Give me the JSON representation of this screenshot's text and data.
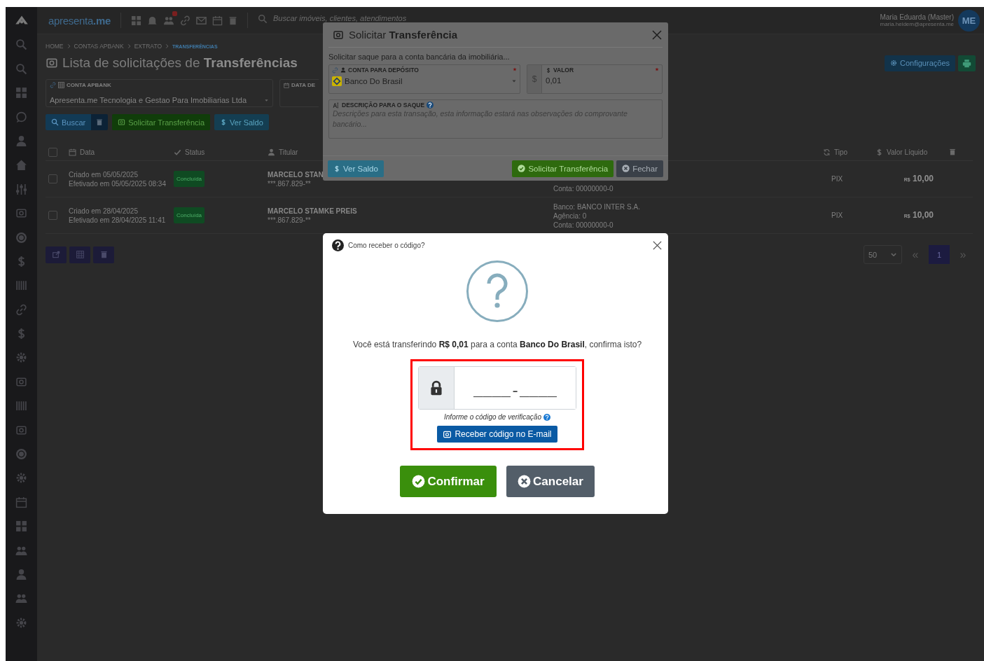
{
  "top_bar": {
    "logo": "apresenta**.me**",
    "search": {
      "placeholder": "Buscar imóveis, clientes, atendimentos"
    },
    "user": {
      "name": "Maria Eduarda (Master)",
      "email": "maria.heidem@apresenta.me",
      "initials": "ME"
    }
  },
  "breadcrumb": [
    {
      "label": "HOME",
      "current": false
    },
    {
      "label": "CONTAS APBANK",
      "current": false
    },
    {
      "label": "EXTRATO",
      "current": false
    },
    {
      "label": "TRANSFERÊNCIAS",
      "current": true
    }
  ],
  "page_title": "Lista de solicitações de **Transferências**",
  "header_buttons": [
    {
      "kind": "settings",
      "label": "Configurações"
    },
    {
      "kind": "print"
    }
  ],
  "filters": {
    "account": {
      "label": "CONTA APBANK",
      "value": "Apresenta.me Tecnologia e Gestao Para Imobiliarias Ltda"
    },
    "date": {
      "label": "DATA DE"
    }
  },
  "actions": [
    {
      "kind": "search",
      "label": "Buscar"
    },
    {
      "kind": "clear"
    },
    {
      "kind": "request",
      "label": "Solicitar Transferência"
    },
    {
      "kind": "balance",
      "label": "Ver Saldo"
    }
  ],
  "table": {
    "select_all": {
      "checked": false
    },
    "columns": [
      {
        "kind": "date",
        "label": "Data"
      },
      {
        "kind": "status",
        "label": "Status"
      },
      {
        "kind": "holder",
        "label": "Titular"
      },
      {
        "kind": "type",
        "label": "Tipo"
      },
      {
        "kind": "amount",
        "label": "Valor Líquido"
      }
    ],
    "rows": [
      {
        "selected": false,
        "created": "Criado em 05/05/2025",
        "done": "Efetivado em 05/05/2025 08:34",
        "status": "Concluída",
        "holder": "MARCELO STAN",
        "document": "***.867.829-**",
        "bank": [
          "Conta: 00000000-0"
        ],
        "type": "PIX",
        "currency": "R$",
        "amount": "10,00"
      },
      {
        "selected": false,
        "created": "Criado em 28/04/2025",
        "done": "Efetivado em 28/04/2025 11:41",
        "status": "Concluída",
        "holder": "MARCELO STAMKE PREIS",
        "document": "***.867.829-**",
        "bank": [
          "Banco: BANCO INTER S.A.",
          "Agência: 0",
          "Conta: 00000000-0"
        ],
        "type": "PIX",
        "currency": "R$",
        "amount": "10,00"
      }
    ]
  },
  "bulk_actions": [
    {
      "kind": "export"
    },
    {
      "kind": "columns"
    },
    {
      "kind": "delete"
    }
  ],
  "pagination": {
    "page_size": "50",
    "previous": "«",
    "next": "»",
    "pages": [
      {
        "label": "1",
        "selected": true
      }
    ]
  },
  "transfer_modal": {
    "title": "Solicitar **Transferência**",
    "subtitle": "Solicitar saque para a conta bancária da imobiliária...",
    "account": {
      "label": "CONTA PARA DEPÓSITO",
      "value": "Banco Do Brasil",
      "required": true
    },
    "amount": {
      "label": "VALOR",
      "prefix": "$",
      "value": "0,01",
      "required": true
    },
    "description": {
      "label": "DESCRIÇÃO PARA O SAQUE",
      "placeholder": "Descrições para esta transação, esta informação estará nas observações do comprovante bancário..."
    },
    "buttons": [
      {
        "kind": "balance",
        "label": "Ver Saldo"
      },
      {
        "kind": "submit",
        "label": "Solicitar Transferência"
      },
      {
        "kind": "close",
        "label": "Fechar"
      }
    ]
  },
  "confirm_modal": {
    "title": "Como receber o código?",
    "message": "Você está transferindo **R$ 0,01** para a conta **Banco Do Brasil**, confirma isto?",
    "code_field": {
      "placeholder": "____-____"
    },
    "hint": "Informe o código de verificação",
    "email_button": "Receber código no E-mail",
    "highlighted": true,
    "buttons": [
      {
        "kind": "confirm",
        "label": "Confirmar"
      },
      {
        "kind": "cancel",
        "label": "Cancelar"
      }
    ]
  }
}
